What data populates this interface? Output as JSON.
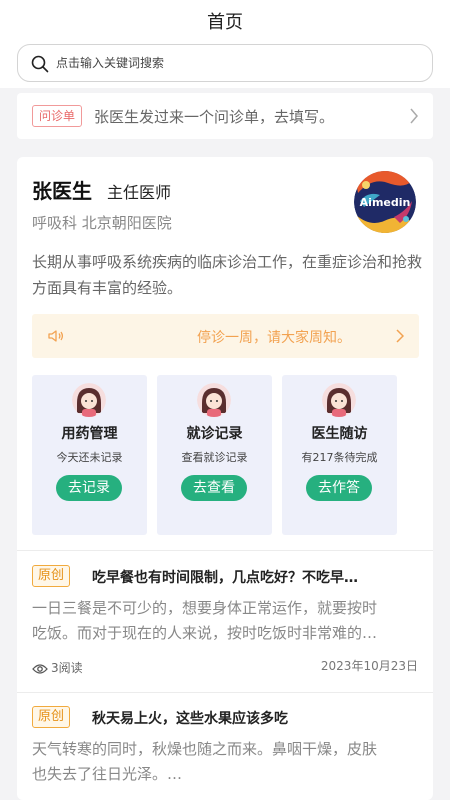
{
  "header": {
    "title": "首页"
  },
  "search": {
    "placeholder": "点击输入关键词搜索",
    "icon": "search-icon"
  },
  "notice": {
    "tag": "问诊单",
    "text": "张医生发过来一个问诊单，去填写。",
    "icon": "chevron-right-icon"
  },
  "doctor": {
    "name": "张医生",
    "title": "主任医师",
    "department": "呼吸科  北京朝阳医院",
    "intro": "长期从事呼吸系统疾病的临床诊治工作，在重症诊治和抢救方面具有丰富的经验。",
    "avatar_text": "Aimedin"
  },
  "announcement": {
    "text": "停诊一周，请大家周知。",
    "icon": "speaker-icon"
  },
  "features": [
    {
      "title": "用药管理",
      "subtitle": "今天还未记录",
      "button": "去记录"
    },
    {
      "title": "就诊记录",
      "subtitle": "查看就诊记录",
      "button": "去查看"
    },
    {
      "title": "医生随访",
      "subtitle": "有217条待完成",
      "button": "去作答"
    }
  ],
  "articles": [
    {
      "tag": "原创",
      "title": "吃早餐也有时间限制，几点吃好？不吃早…",
      "body_line1": "一日三餐是不可少的，想要身体正常运作，就要按时",
      "body_line2": "吃饭。而对于现在的人来说，按时吃饭时非常难的…",
      "reads": "3阅读",
      "date": "2023年10月23日"
    },
    {
      "tag": "原创",
      "title": "秋天易上火，这些水果应该多吃",
      "body_line1": "天气转寒的同时，秋燥也随之而来。鼻咽干燥，皮肤",
      "body_line2": "也失去了往日光泽。…"
    }
  ],
  "colors": {
    "accent_green": "#26b07f",
    "tag_orange": "#e6921a",
    "notice_red": "#e96a6a",
    "announce_bg": "#fdf5e6"
  }
}
